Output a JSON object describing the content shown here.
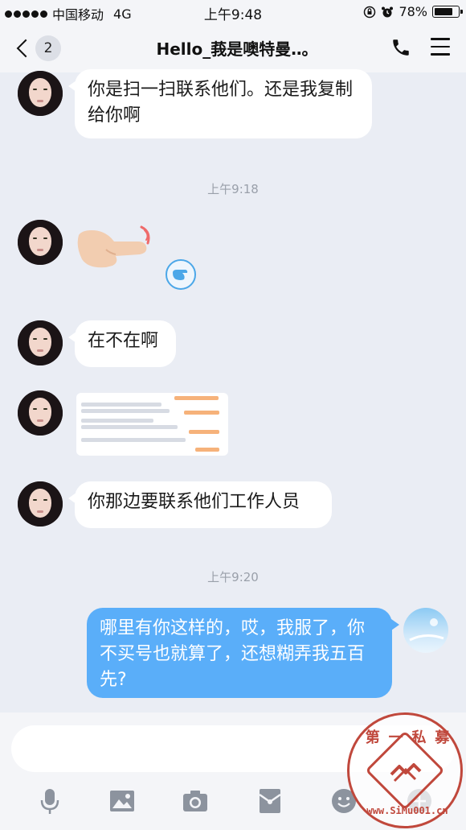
{
  "status_bar": {
    "carrier": "中国移动",
    "network": "4G",
    "time": "上午9:48",
    "battery": "78%",
    "battery_level": 0.78
  },
  "nav": {
    "back_count": "2",
    "title": "Hello_莪是噢特曼‥。"
  },
  "messages": [
    {
      "type": "text",
      "direction": "in",
      "text": "你是扫一扫联系他们。还是我复制给你啊"
    },
    {
      "type": "timestamp",
      "text": "上午9:18"
    },
    {
      "type": "sticker",
      "direction": "in",
      "sticker": "pointing-hand"
    },
    {
      "type": "text",
      "direction": "in",
      "text": "在不在啊"
    },
    {
      "type": "image",
      "direction": "in",
      "image": "chat-screenshot"
    },
    {
      "type": "text",
      "direction": "in",
      "text": "你那边要联系他们工作人员"
    },
    {
      "type": "timestamp",
      "text": "上午9:20"
    },
    {
      "type": "text",
      "direction": "out",
      "text": "哪里有你这样的，哎，我服了，你不买号也就算了，还想糊弄我五百先?"
    }
  ],
  "toolbar": [
    "microphone-icon",
    "image-icon",
    "camera-icon",
    "red-packet-icon",
    "emoji-icon",
    "more-icon"
  ],
  "watermark": {
    "top_text": "第 一 私 募",
    "bottom_text": "www.SiMu001.cn"
  },
  "colors": {
    "background": "#eaedf4",
    "outgoing_bubble": "#5aaef9",
    "incoming_bubble": "#ffffff",
    "watermark": "#c0483c"
  }
}
